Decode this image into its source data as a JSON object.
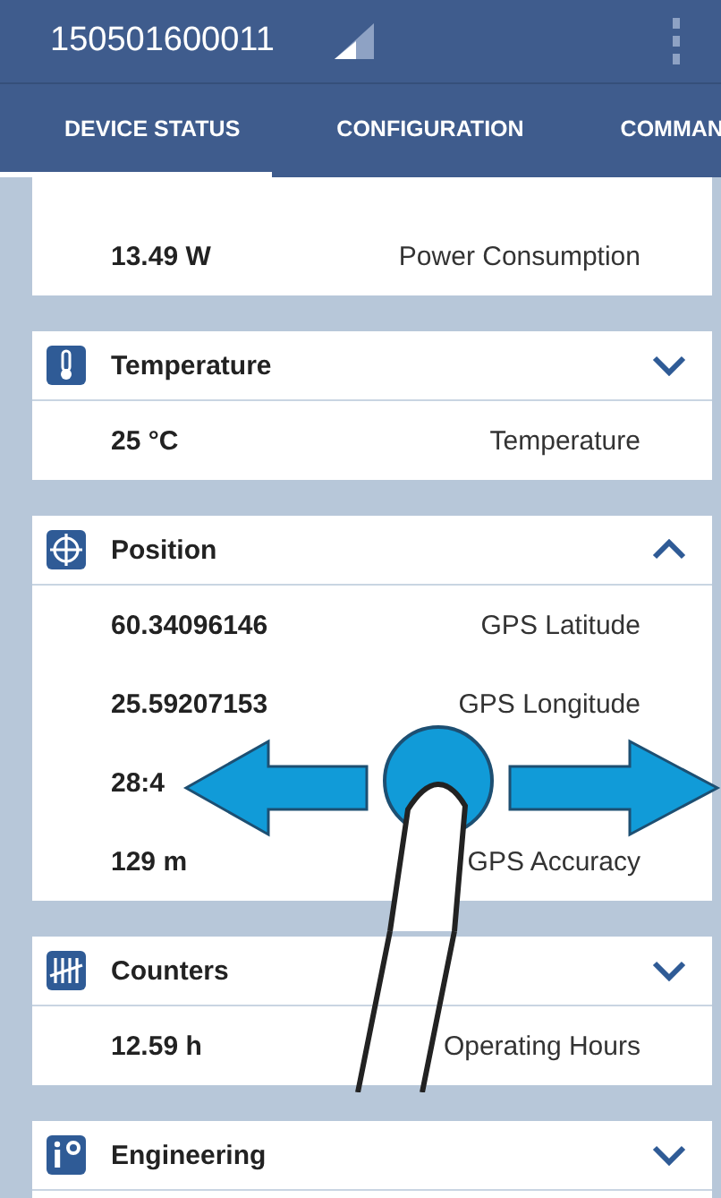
{
  "app_bar": {
    "title": "150501600011"
  },
  "tabs": [
    {
      "label": "DEVICE STATUS",
      "selected": true
    },
    {
      "label": "CONFIGURATION",
      "selected": false
    },
    {
      "label": "COMMAN",
      "selected": false
    }
  ],
  "sections": [
    {
      "rows": [
        {
          "value": "13.49 W",
          "label": "Power Consumption"
        }
      ]
    },
    {
      "title": "Temperature",
      "expanded": false,
      "rows": [
        {
          "value": "25 °C",
          "label": "Temperature"
        }
      ]
    },
    {
      "title": "Position",
      "expanded": true,
      "rows": [
        {
          "value": "60.34096146",
          "label": "GPS Latitude"
        },
        {
          "value": "25.59207153",
          "label": "GPS Longitude"
        },
        {
          "value": "28:4"
        },
        {
          "value": "129 m",
          "label": "GPS Accuracy"
        }
      ]
    },
    {
      "title": "Counters",
      "expanded": false,
      "rows": [
        {
          "value": "12.59 h",
          "label": "Operating Hours"
        }
      ]
    },
    {
      "title": "Engineering",
      "expanded": false
    }
  ]
}
